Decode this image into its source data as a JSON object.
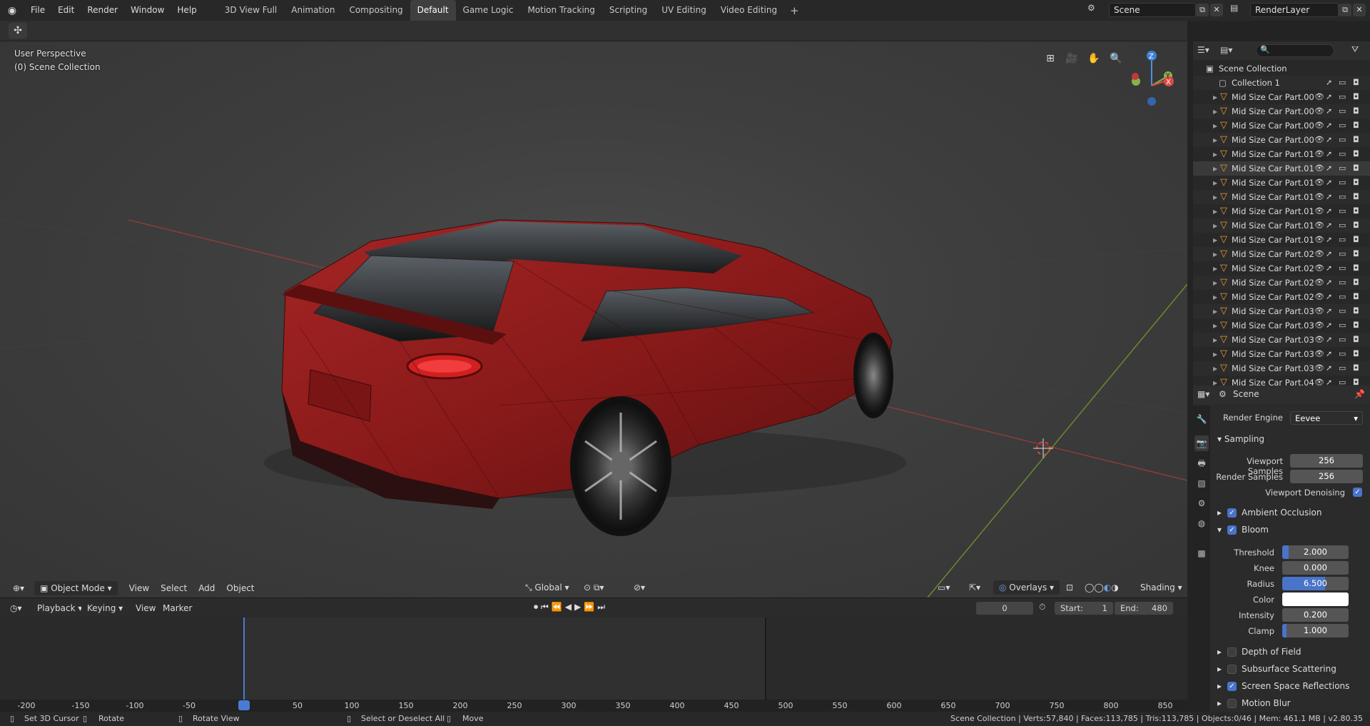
{
  "topbar": {
    "menus": [
      "File",
      "Edit",
      "Render",
      "Window",
      "Help"
    ],
    "workspaces": [
      "3D View Full",
      "Animation",
      "Compositing",
      "Default",
      "Game Logic",
      "Motion Tracking",
      "Scripting",
      "UV Editing",
      "Video Editing"
    ],
    "active_workspace": "Default",
    "scene_name": "Scene",
    "view_layer": "RenderLayer"
  },
  "viewport": {
    "perspective_label": "User Perspective",
    "collection_label": "(0) Scene Collection",
    "gizmo": {
      "z": "Z",
      "y": "Y",
      "x": "X"
    }
  },
  "vp_header": {
    "mode": "Object Mode",
    "menus": [
      "View",
      "Select",
      "Add",
      "Object"
    ],
    "orientation": "Global",
    "overlays": "Overlays",
    "shading": "Shading"
  },
  "timeline": {
    "playback": "Playback",
    "keying": "Keying",
    "view": "View",
    "marker": "Marker",
    "current_frame": "0",
    "start_label": "Start:",
    "start": "1",
    "end_label": "End:",
    "end": "480",
    "ticks": [
      "-200",
      "-150",
      "-100",
      "-50",
      "0",
      "50",
      "100",
      "150",
      "200",
      "250",
      "300",
      "350",
      "400",
      "450",
      "500",
      "550",
      "600",
      "650",
      "700",
      "750",
      "800",
      "850"
    ]
  },
  "statusbar": {
    "set_cursor": "Set 3D Cursor",
    "rotate": "Rotate",
    "rotate_view": "Rotate View",
    "select_all": "Select or Deselect All",
    "move": "Move",
    "stats": "Scene Collection | Verts:57,840 | Faces:113,785 | Tris:113,785 | Objects:0/46 | Mem: 461.1 MB | v2.80.35"
  },
  "outliner": {
    "root": "Scene Collection",
    "collection": "Collection 1",
    "items": [
      "Mid Size Car Part.00",
      "Mid Size Car Part.00",
      "Mid Size Car Part.00",
      "Mid Size Car Part.00",
      "Mid Size Car Part.01",
      "Mid Size Car Part.01",
      "Mid Size Car Part.01",
      "Mid Size Car Part.01",
      "Mid Size Car Part.01",
      "Mid Size Car Part.01",
      "Mid Size Car Part.01",
      "Mid Size Car Part.02",
      "Mid Size Car Part.02",
      "Mid Size Car Part.02",
      "Mid Size Car Part.02",
      "Mid Size Car Part.03",
      "Mid Size Car Part.03",
      "Mid Size Car Part.03",
      "Mid Size Car Part.03",
      "Mid Size Car Part.03",
      "Mid Size Car Part.04"
    ],
    "selected_index": 5
  },
  "properties": {
    "context": "Scene",
    "render_engine_label": "Render Engine",
    "render_engine": "Eevee",
    "sampling": "Sampling",
    "viewport_samples_label": "Viewport Samples",
    "viewport_samples": "256",
    "render_samples_label": "Render Samples",
    "render_samples": "256",
    "viewport_denoising": "Viewport Denoising",
    "ambient_occlusion": "Ambient Occlusion",
    "bloom": "Bloom",
    "threshold_label": "Threshold",
    "threshold": "2.000",
    "threshold_fill": 0.1,
    "knee_label": "Knee",
    "knee": "0.000",
    "knee_fill": 0,
    "radius_label": "Radius",
    "radius": "6.500",
    "radius_fill": 0.65,
    "color_label": "Color",
    "intensity_label": "Intensity",
    "intensity": "0.200",
    "intensity_fill": 0.0,
    "clamp_label": "Clamp",
    "clamp": "1.000",
    "clamp_fill": 0.02,
    "depth_of_field": "Depth of Field",
    "subsurface": "Subsurface Scattering",
    "ssr": "Screen Space Reflections",
    "motion_blur": "Motion Blur"
  },
  "colors": {
    "accent": "#4a74c9",
    "mesh_icon": "#e89a3c",
    "car_body": "#8e1c1c"
  }
}
